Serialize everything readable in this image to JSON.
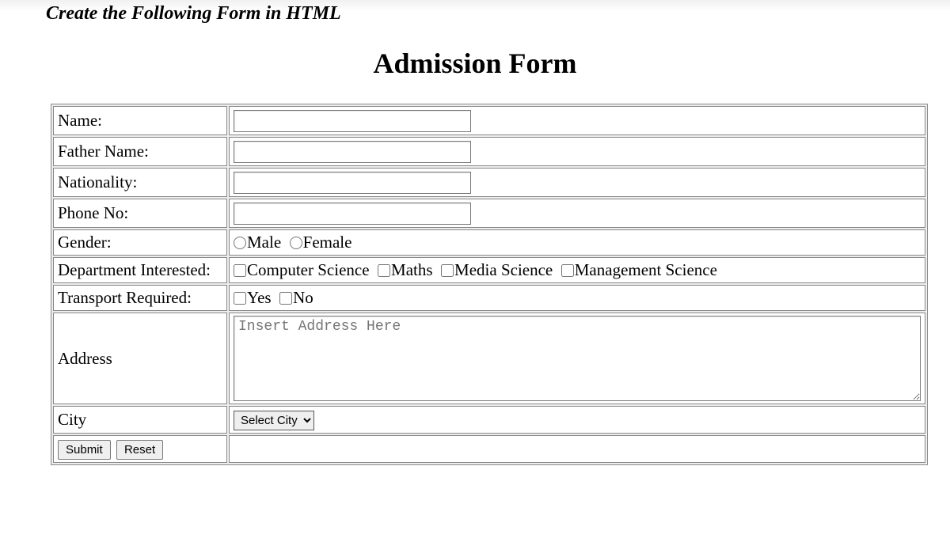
{
  "instruction": "Create the Following Form in HTML",
  "heading": "Admission Form",
  "labels": {
    "name": "Name:",
    "father": "Father Name:",
    "nationality": "Nationality:",
    "phone": "Phone No:",
    "gender": "Gender:",
    "department": "Department Interested:",
    "transport": "Transport Required:",
    "address": "Address",
    "city": "City"
  },
  "gender": {
    "male": "Male",
    "female": "Female"
  },
  "department": {
    "cs": "Computer Science",
    "maths": "Maths",
    "media": "Media Science",
    "mgmt": "Management Science"
  },
  "transport": {
    "yes": "Yes",
    "no": "No"
  },
  "address_placeholder": "Insert Address Here",
  "city_default": "Select City",
  "buttons": {
    "submit": "Submit",
    "reset": "Reset"
  }
}
